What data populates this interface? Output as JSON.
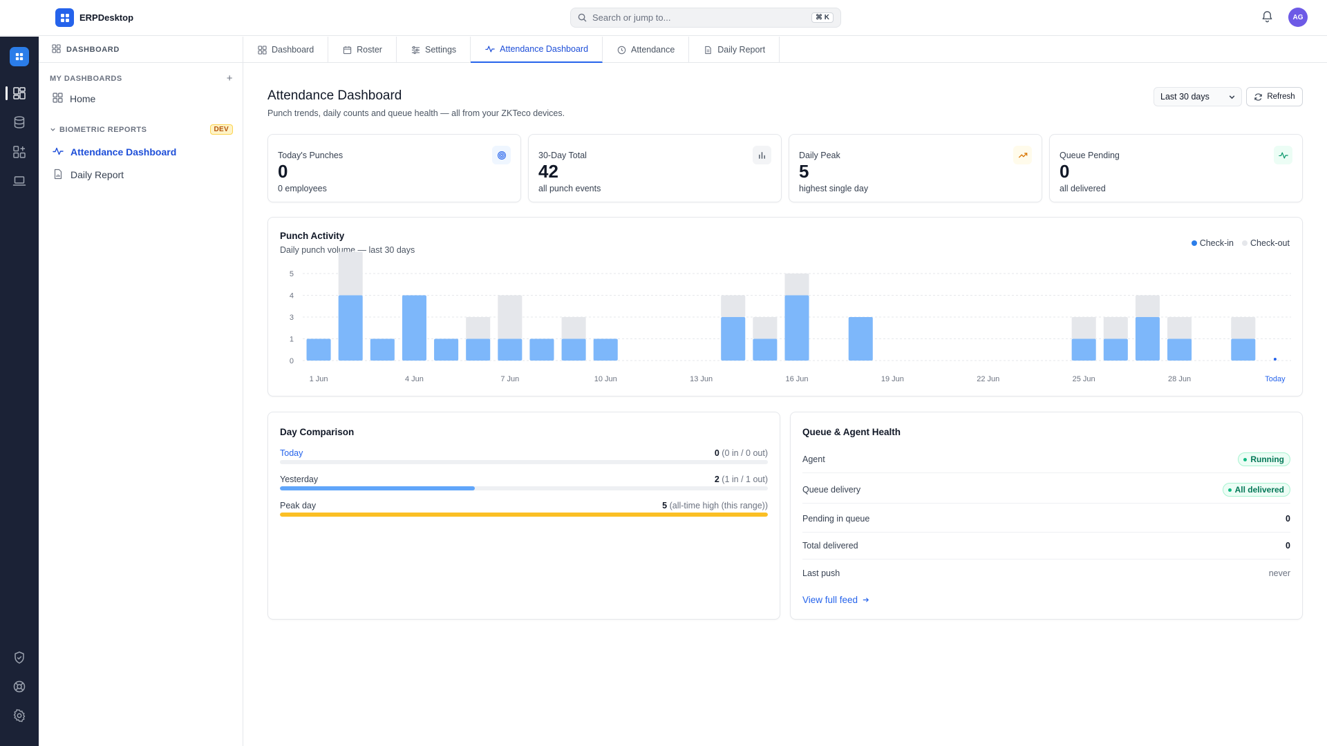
{
  "app": {
    "name": "ERPDesktop",
    "search_placeholder": "Search or jump to...",
    "search_shortcut": "⌘ K",
    "avatar_initials": "AG",
    "accent": "#2563eb"
  },
  "rail": {
    "items": [
      {
        "icon": "dashboard-icon",
        "active": true
      },
      {
        "icon": "database-icon"
      },
      {
        "icon": "apps-add-icon"
      },
      {
        "icon": "laptop-icon"
      }
    ],
    "bottom_items": [
      {
        "icon": "shield-check-icon"
      },
      {
        "icon": "lifebuoy-icon"
      },
      {
        "icon": "gear-icon"
      }
    ]
  },
  "sidebar": {
    "header": "DASHBOARD",
    "my_dashboards_label": "MY DASHBOARDS",
    "home_label": "Home",
    "biometric_label": "BIOMETRIC REPORTS",
    "dev_badge": "DEV",
    "items": [
      {
        "label": "Attendance Dashboard",
        "icon": "activity-icon",
        "active": true
      },
      {
        "label": "Daily Report",
        "icon": "report-icon"
      }
    ]
  },
  "tabs": [
    {
      "label": "Dashboard",
      "icon": "dashboard-icon"
    },
    {
      "label": "Roster",
      "icon": "calendar-icon"
    },
    {
      "label": "Settings",
      "icon": "sliders-icon"
    },
    {
      "label": "Attendance Dashboard",
      "icon": "activity-icon",
      "active": true
    },
    {
      "label": "Attendance",
      "icon": "clock-icon"
    },
    {
      "label": "Daily Report",
      "icon": "file-icon"
    }
  ],
  "page": {
    "title": "Attendance Dashboard",
    "subtitle": "Punch trends, daily counts and queue health — all from your ZKTeco devices.",
    "range_value": "Last 30 days",
    "refresh_label": "Refresh"
  },
  "stats": [
    {
      "label": "Today's Punches",
      "value": "0",
      "sub": "0 employees",
      "icon": "fingerprint-icon",
      "icon_color": "#2563eb",
      "icon_bg": "#eff6ff"
    },
    {
      "label": "30-Day Total",
      "value": "42",
      "sub": "all punch events",
      "icon": "bar-chart-icon",
      "icon_color": "#4b5563",
      "icon_bg": "#f3f4f6"
    },
    {
      "label": "Daily Peak",
      "value": "5",
      "sub": "highest single day",
      "icon": "trending-up-icon",
      "icon_color": "#d97706",
      "icon_bg": "#fffbeb"
    },
    {
      "label": "Queue Pending",
      "value": "0",
      "sub": "all delivered",
      "icon": "activity-icon",
      "icon_color": "#059669",
      "icon_bg": "#ecfdf5"
    }
  ],
  "punch_activity": {
    "title": "Punch Activity",
    "subtitle": "Daily punch volume — last 30 days"
  },
  "chart_data": {
    "type": "bar",
    "stacked": true,
    "categories": [
      "1 Jun",
      "2 Jun",
      "3 Jun",
      "4 Jun",
      "5 Jun",
      "6 Jun",
      "7 Jun",
      "8 Jun",
      "9 Jun",
      "10 Jun",
      "11 Jun",
      "12 Jun",
      "13 Jun",
      "14 Jun",
      "15 Jun",
      "16 Jun",
      "17 Jun",
      "18 Jun",
      "19 Jun",
      "20 Jun",
      "21 Jun",
      "22 Jun",
      "23 Jun",
      "24 Jun",
      "25 Jun",
      "26 Jun",
      "27 Jun",
      "28 Jun",
      "29 Jun",
      "30 Jun",
      "Today"
    ],
    "tick_labels": [
      "1 Jun",
      "4 Jun",
      "7 Jun",
      "10 Jun",
      "13 Jun",
      "16 Jun",
      "19 Jun",
      "22 Jun",
      "25 Jun",
      "28 Jun",
      "Today"
    ],
    "y_ticks": [
      "0",
      "1",
      "3",
      "4",
      "5"
    ],
    "ylim": [
      0,
      5
    ],
    "series": [
      {
        "name": "Check-in",
        "color": "#7db7fa",
        "values": [
          1,
          3,
          1,
          3,
          1,
          1,
          1,
          1,
          1,
          1,
          0,
          0,
          0,
          2,
          1,
          3,
          0,
          2,
          0,
          0,
          0,
          0,
          0,
          0,
          1,
          1,
          2,
          1,
          0,
          1,
          0
        ]
      },
      {
        "name": "Check-out",
        "color": "#e5e7eb",
        "values": [
          0,
          2,
          0,
          0,
          0,
          1,
          2,
          0,
          1,
          0,
          0,
          0,
          0,
          1,
          1,
          1,
          0,
          0,
          0,
          0,
          0,
          0,
          0,
          0,
          1,
          1,
          1,
          1,
          0,
          1,
          0
        ]
      }
    ],
    "legend": "top-right",
    "grid": true
  },
  "legend": {
    "checkin": "Check-in",
    "checkout": "Check-out",
    "checkin_color": "#2b7de9",
    "checkout_color": "#e5e7eb"
  },
  "day_comparison": {
    "title": "Day Comparison",
    "rows": [
      {
        "label": "Today",
        "value": "0",
        "detail": "(0 in / 0 out)",
        "fraction": 0,
        "color": "#3b82f6"
      },
      {
        "label": "Yesterday",
        "value": "2",
        "detail": "(1 in / 1 out)",
        "fraction": 0.4,
        "color": "#60a5fa"
      },
      {
        "label": "Peak day",
        "value": "5",
        "detail": "(all-time high (this range))",
        "fraction": 1,
        "color": "#fbbf24"
      }
    ]
  },
  "queue_health": {
    "title": "Queue & Agent Health",
    "agent_label": "Agent",
    "agent_status": "Running",
    "delivery_label": "Queue delivery",
    "delivery_status": "All delivered",
    "pending_label": "Pending in queue",
    "pending_value": "0",
    "delivered_label": "Total delivered",
    "delivered_value": "0",
    "last_push_label": "Last push",
    "last_push_value": "never",
    "feed_link": "View full feed"
  }
}
